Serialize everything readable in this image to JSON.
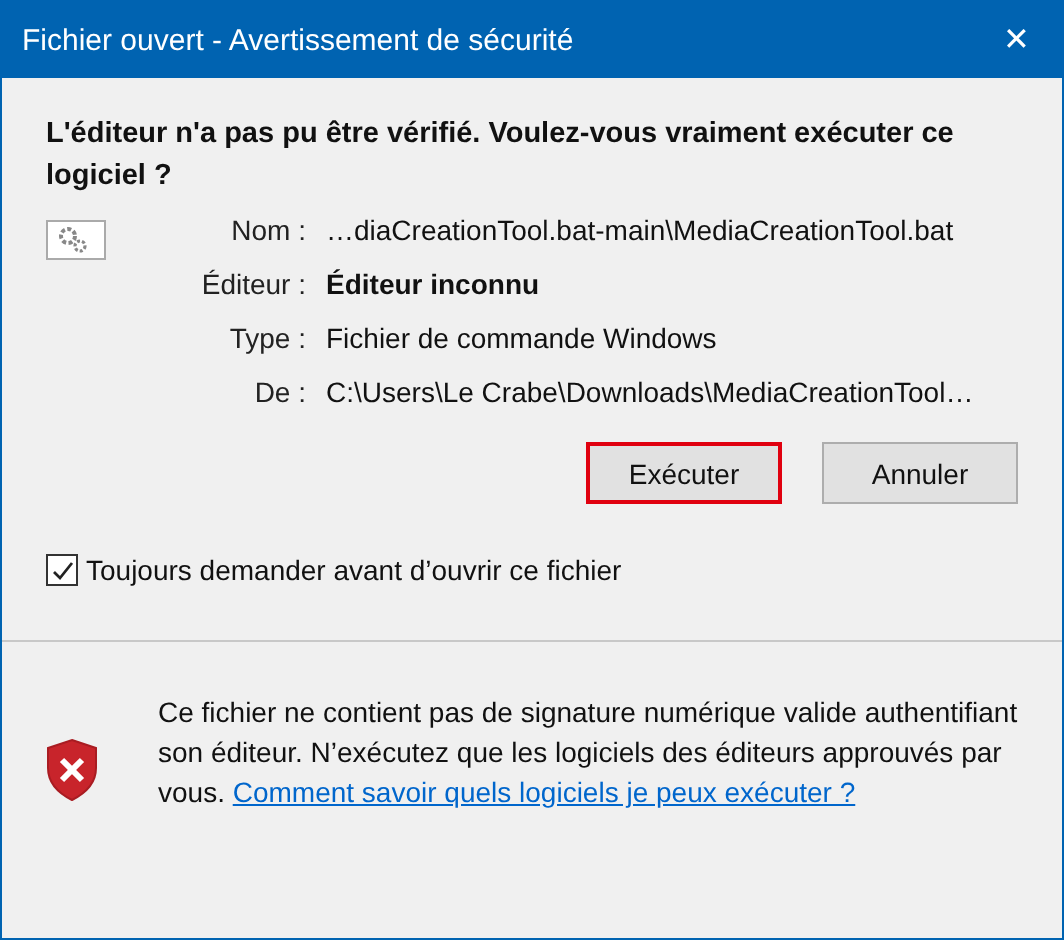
{
  "window": {
    "title": "Fichier ouvert - Avertissement de sécurité",
    "close": "✕"
  },
  "heading": "L'éditeur n'a pas pu être vérifié. Voulez-vous vraiment exécuter ce logiciel ?",
  "fields": [
    {
      "label": "Nom :",
      "value": "…diaCreationTool.bat-main\\MediaCreationTool.bat",
      "emphasis": false
    },
    {
      "label": "Éditeur :",
      "value": "Éditeur inconnu",
      "emphasis": true
    },
    {
      "label": "Type :",
      "value": "Fichier de commande Windows",
      "emphasis": false
    },
    {
      "label": "De :",
      "value": "C:\\Users\\Le Crabe\\Downloads\\MediaCreationTool…",
      "emphasis": false
    }
  ],
  "buttons": [
    {
      "label": "Exécuter",
      "highlighted": true
    },
    {
      "label": "Annuler",
      "highlighted": false
    }
  ],
  "checkbox": {
    "label": "Toujours demander avant d’ouvrir ce fichier",
    "checked": true
  },
  "footer": {
    "text": "Ce fichier ne contient pas de signature numérique valide authentifiant son éditeur. N’exécutez que les logiciels des éditeurs approuvés par vous.",
    "link": "Comment savoir quels logiciels je peux exécuter ?"
  }
}
